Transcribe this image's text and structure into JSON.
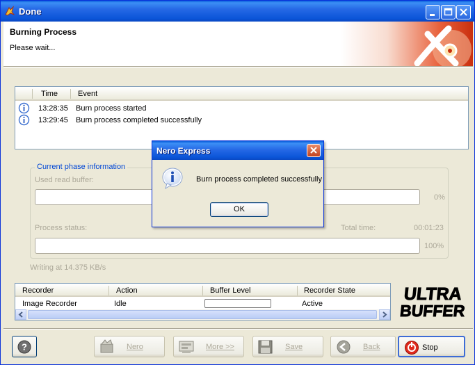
{
  "window": {
    "title": "Done"
  },
  "header": {
    "title": "Burning Process",
    "subtitle": "Please wait..."
  },
  "event_log": {
    "columns": [
      "Time",
      "Event"
    ],
    "rows": [
      {
        "time": "13:28:35",
        "event": "Burn process started",
        "icon": "info-icon"
      },
      {
        "time": "13:29:45",
        "event": "Burn process completed successfully",
        "icon": "info-icon"
      }
    ]
  },
  "phase": {
    "legend": "Current phase information",
    "used_buffer_label": "Used read buffer:",
    "used_buffer_pct": "0%",
    "process_status_label": "Process status:",
    "total_time_label": "Total time:",
    "total_time": "00:01:23",
    "progress_pct": "100%",
    "writing_speed": "Writing at 14.375 KB/s"
  },
  "recorders": {
    "columns": [
      "Recorder",
      "Action",
      "Buffer Level",
      "Recorder State"
    ],
    "rows": [
      {
        "recorder": "Image Recorder",
        "action": "Idle",
        "state": "Active"
      }
    ]
  },
  "buttons": {
    "nero": "Nero",
    "more": "More >>",
    "save": "Save",
    "back": "Back",
    "stop": "Stop"
  },
  "dialog": {
    "title": "Nero Express",
    "message": "Burn process completed successfully",
    "ok": "OK"
  },
  "icons": {
    "help": "help-icon",
    "nero": "nero-icon",
    "more": "more-icon",
    "save": "floppy-icon",
    "back": "back-arrow-icon",
    "stop": "stop-icon",
    "dialog": "info-icon"
  }
}
